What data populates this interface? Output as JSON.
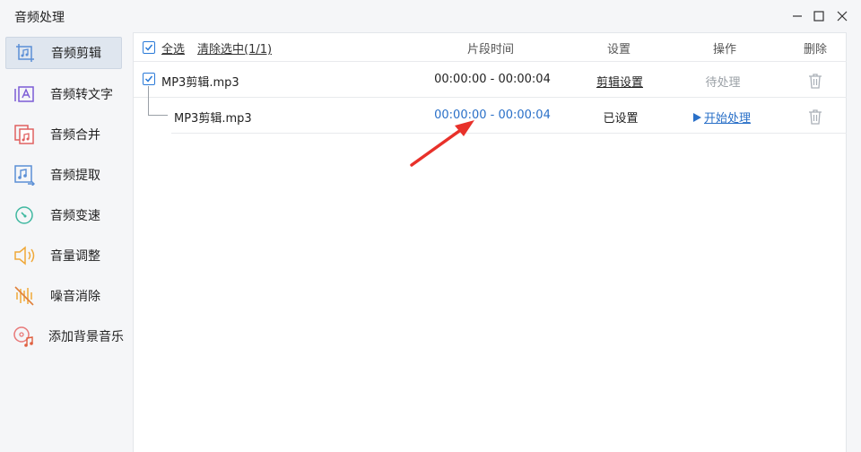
{
  "window": {
    "title": "音频处理"
  },
  "sidebar": {
    "items": [
      {
        "label": "音频剪辑",
        "icon": "audio-cut-icon"
      },
      {
        "label": "音频转文字",
        "icon": "audio-to-text-icon"
      },
      {
        "label": "音频合并",
        "icon": "audio-merge-icon"
      },
      {
        "label": "音频提取",
        "icon": "audio-extract-icon"
      },
      {
        "label": "音频变速",
        "icon": "audio-speed-icon"
      },
      {
        "label": "音量调整",
        "icon": "volume-adjust-icon"
      },
      {
        "label": "噪音消除",
        "icon": "noise-remove-icon"
      },
      {
        "label": "添加背景音乐",
        "icon": "add-bgm-icon"
      }
    ],
    "active_index": 0
  },
  "header": {
    "select_all": "全选",
    "clear_selected": "清除选中(1/1)",
    "col_segment_time": "片段时间",
    "col_settings": "设置",
    "col_action": "操作",
    "col_delete": "删除"
  },
  "rows": [
    {
      "filename": "MP3剪辑.mp3",
      "segment_time": "00:00:00 - 00:00:04",
      "settings": "剪辑设置",
      "action": "待处理"
    },
    {
      "filename": "MP3剪辑.mp3",
      "segment_time": "00:00:00 - 00:00:04",
      "settings": "已设置",
      "action": "开始处理"
    }
  ],
  "colors": {
    "accent": "#2a7ad8",
    "link_blue": "#2a70c8",
    "arrow_red": "#e8312a",
    "muted": "#9aa0a6"
  }
}
